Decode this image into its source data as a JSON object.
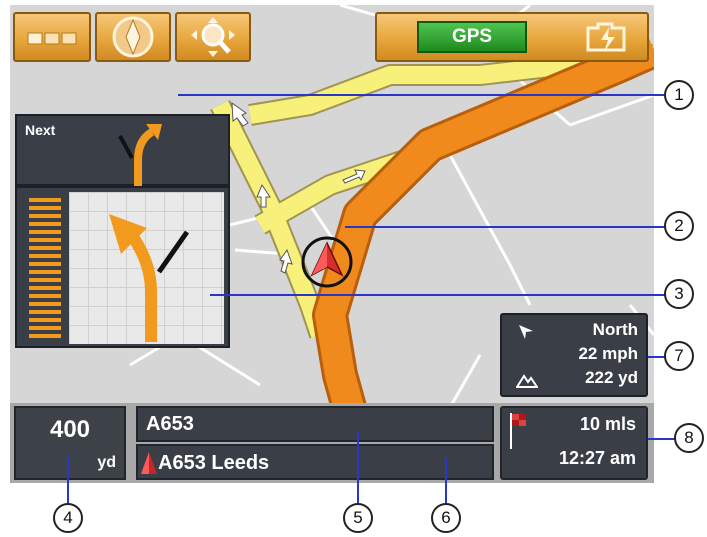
{
  "toolbar": {
    "buttons": [
      {
        "name": "menu-button",
        "icon": "menu-squares-icon"
      },
      {
        "name": "compass-button",
        "icon": "compass-icon"
      },
      {
        "name": "zoom-button",
        "icon": "zoom-pan-icon"
      }
    ],
    "gps_label": "GPS",
    "battery_icon": "battery-charging-icon"
  },
  "next_turn": {
    "label": "Next",
    "icon": "turn-right-fork-arrow-icon"
  },
  "maneuver": {
    "icon": "bear-left-fork-arrow-icon"
  },
  "info_panel": {
    "heading": "North",
    "speed": "22 mph",
    "altitude": "222 yd"
  },
  "distance": {
    "value": "400",
    "unit": "yd"
  },
  "street": {
    "current": "A653",
    "next": "A653 Leeds"
  },
  "trip": {
    "remaining": "10 mls",
    "eta": "12:27 am"
  },
  "callouts": [
    "1",
    "2",
    "3",
    "4",
    "5",
    "6",
    "7",
    "8"
  ],
  "colors": {
    "route": "#f08a1d",
    "panel": "#3a3f47",
    "button": "#e8a63d",
    "gps": "#2ea82e",
    "callout_line": "#2a36c8",
    "vehicle": "#c1272d"
  }
}
